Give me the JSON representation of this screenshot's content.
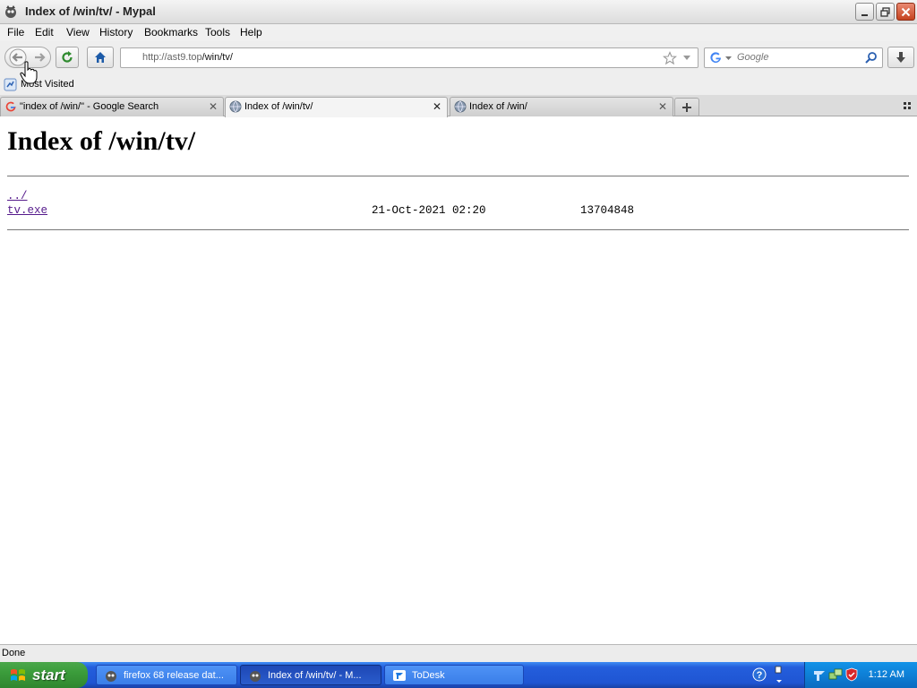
{
  "window": {
    "title": "Index of /win/tv/ - Mypal"
  },
  "menu": {
    "items": [
      "File",
      "Edit",
      "View",
      "History",
      "Bookmarks",
      "Tools",
      "Help"
    ]
  },
  "nav": {
    "url_host": "http://ast9.top",
    "url_path": "/win/tv/",
    "search_placeholder": "Google"
  },
  "bookmarks": {
    "most_visited": "Most Visited"
  },
  "tabs": [
    {
      "label": "\"index of /win/\" - Google Search",
      "icon": "google-icon",
      "active": false
    },
    {
      "label": "Index of /win/tv/",
      "icon": "globe-icon",
      "active": true
    },
    {
      "label": "Index of /win/",
      "icon": "globe-icon",
      "active": false
    }
  ],
  "content": {
    "heading": "Index of /win/tv/",
    "entries": [
      {
        "name": "../",
        "date": "",
        "size": ""
      },
      {
        "name": "tv.exe",
        "date": "21-Oct-2021 02:20",
        "size": "13704848"
      }
    ]
  },
  "status": {
    "text": "Done"
  },
  "taskbar": {
    "start_label": "start",
    "items": [
      {
        "label": "firefox 68 release dat...",
        "active": false
      },
      {
        "label": "Index of /win/tv/ - M...",
        "active": true
      },
      {
        "label": "ToDesk",
        "active": false
      }
    ],
    "clock": "1:12 AM"
  },
  "colors": {
    "link_visited": "#551a8b",
    "taskbar_blue": "#245edc",
    "start_green": "#3b9c3b"
  }
}
